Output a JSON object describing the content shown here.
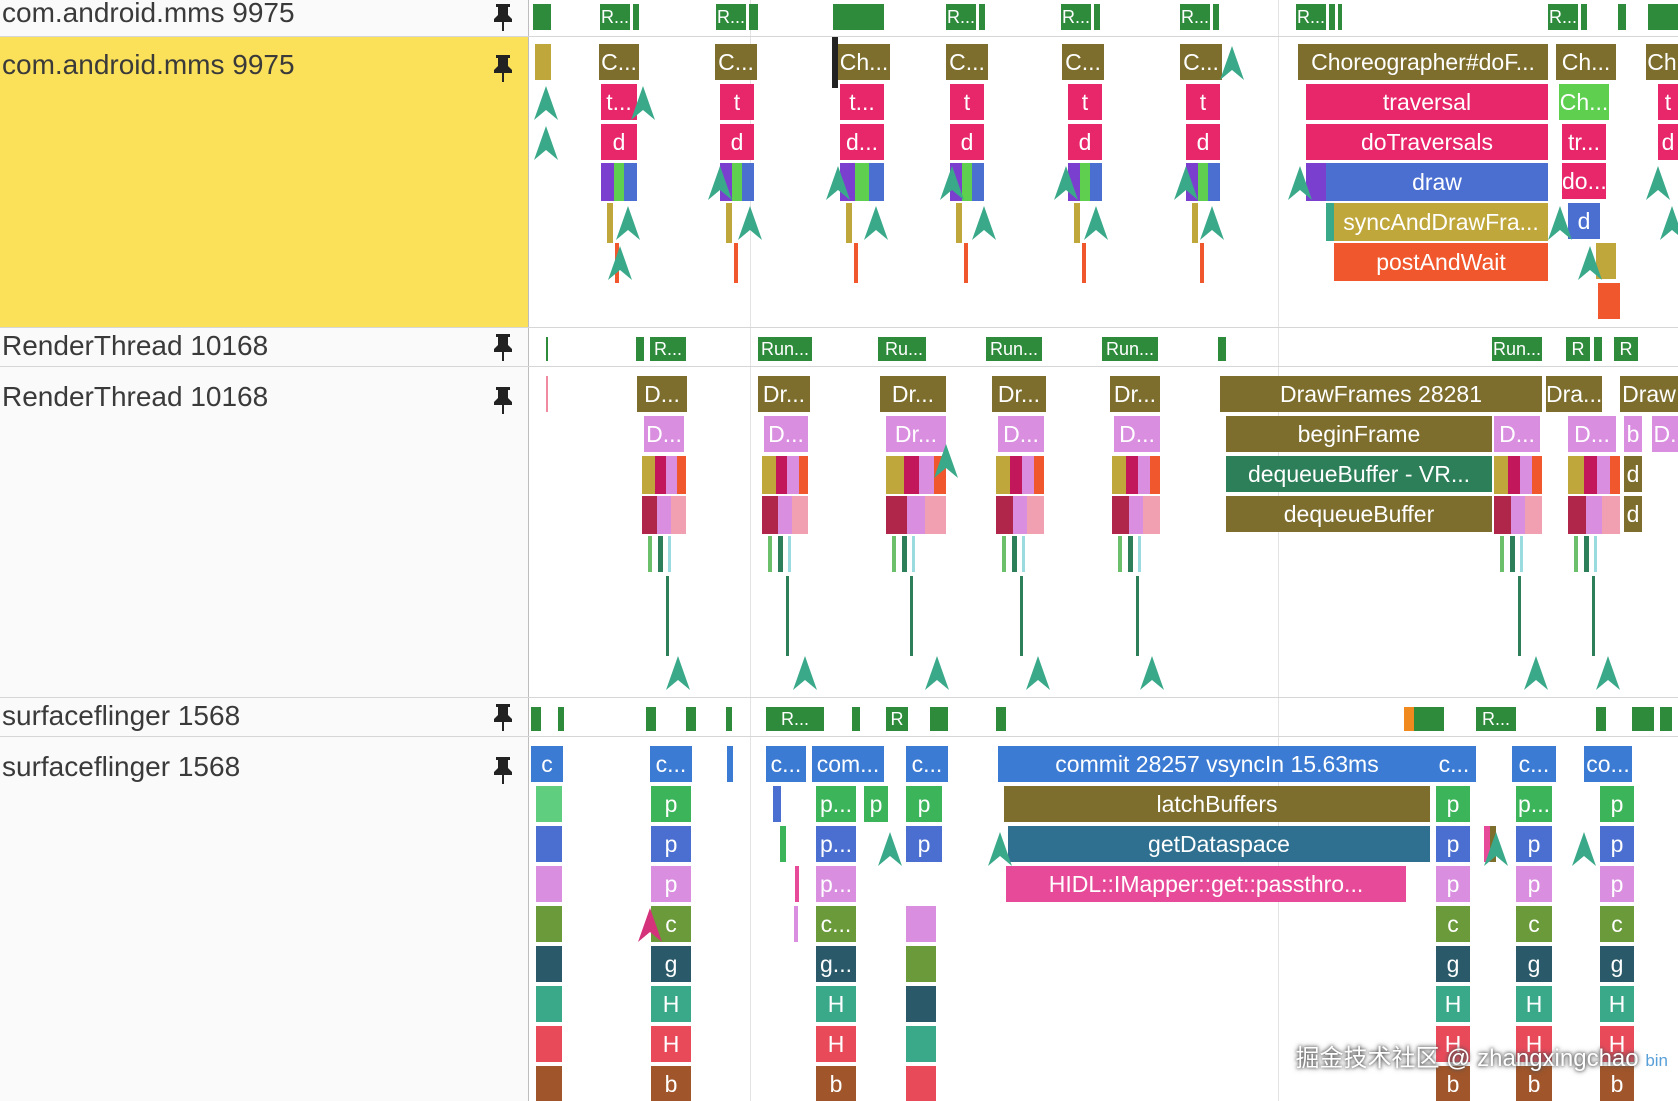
{
  "tracks": [
    {
      "name": "com.android.mms 9975",
      "highlighted": false
    },
    {
      "name": "com.android.mms 9975",
      "highlighted": true
    },
    {
      "name": "RenderThread 10168",
      "highlighted": false
    },
    {
      "name": "RenderThread 10168",
      "highlighted": false
    },
    {
      "name": "surfaceflinger 1568",
      "highlighted": false
    },
    {
      "name": "surfaceflinger 1568",
      "highlighted": false
    }
  ],
  "pin_icon": "pin-icon",
  "slice_labels": {
    "main": {
      "run_state": [
        "R...",
        "R...",
        "R...",
        "R...",
        "R...",
        "R...",
        "R..."
      ],
      "choreographer_short": [
        "C...",
        "C...",
        "Ch...",
        "C...",
        "C...",
        "C...",
        "Ch...",
        "Ch"
      ],
      "traversal_short": [
        "t...",
        "t",
        "t...",
        "t",
        "t",
        "t",
        "Ch...",
        "t"
      ],
      "draw_short": [
        "d",
        "d",
        "d...",
        "d",
        "d",
        "d",
        "tr...",
        "d",
        "do...",
        "d"
      ],
      "expanded": {
        "choreographer": "Choreographer#doF...",
        "traversal": "traversal",
        "doTraversals": "doTraversals",
        "draw": "draw",
        "syncAndDrawFrame": "syncAndDrawFra...",
        "postAndWait": "postAndWait"
      }
    },
    "render": {
      "run_state": [
        "R...",
        "Run...",
        "Ru...",
        "Run...",
        "Run...",
        "Run...",
        "R",
        "R"
      ],
      "drawframes_short": [
        "D...",
        "Dr...",
        "Dr...",
        "Dr...",
        "Dr...",
        "Dra...",
        "Draw"
      ],
      "begin_short": [
        "D...",
        "D...",
        "Dr...",
        "D...",
        "D...",
        "D...",
        "D...",
        "b",
        "D."
      ],
      "deq_short": [
        "d",
        "d"
      ],
      "expanded": {
        "drawFrames": "DrawFrames 28281",
        "beginFrame": "beginFrame",
        "dequeueBufferVR": "dequeueBuffer - VR...",
        "dequeueBuffer": "dequeueBuffer"
      }
    },
    "sf": {
      "run_state": [
        "R...",
        "R",
        "R..."
      ],
      "commit_short": [
        "c",
        "c...",
        "c...",
        "com...",
        "c...",
        "c...",
        "c...",
        "co..."
      ],
      "p_labels": [
        "p",
        "p...",
        "p",
        "p",
        "p",
        "p...",
        "p"
      ],
      "p2_labels": [
        "p",
        "p...",
        "p",
        "p",
        "p",
        "p"
      ],
      "p3_labels": [
        "p",
        "p...",
        "p",
        "p",
        "p"
      ],
      "c_labels": [
        "c",
        "c...",
        "c",
        "c",
        "c"
      ],
      "g_labels": [
        "g",
        "g...",
        "g",
        "g",
        "g"
      ],
      "H_labels": [
        "H",
        "H",
        "H",
        "H",
        "H"
      ],
      "H2_labels": [
        "H",
        "H",
        "H",
        "H",
        "H"
      ],
      "b_labels": [
        "b",
        "b",
        "b",
        "b",
        "b"
      ],
      "expanded": {
        "commit": "commit 28257 vsyncIn 15.63ms",
        "latchBuffers": "latchBuffers",
        "getDataspace": "getDataspace",
        "hidl": "HIDL::IMapper::get::passthro..."
      }
    }
  },
  "watermark": "掘金技术社区 @ zhangxingchao",
  "watermark_tail": "bin",
  "colors": {
    "run_green": "#2e8b3c",
    "olive": "#7d6e2e",
    "pink": "#e8266a",
    "blue": "#4a6fd1",
    "orange": "#f0572d",
    "mustard": "#bfa73c",
    "teal": "#2c7f59",
    "violet": "#d98ee0",
    "sf_blue": "#3c7bd3",
    "highlight": "#fbe05a"
  }
}
